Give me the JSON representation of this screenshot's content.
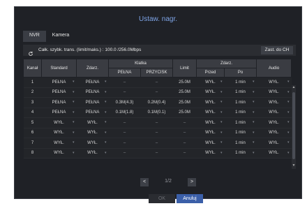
{
  "title": "Ustaw. nagr.",
  "tabs": [
    "NVR",
    "Kamera"
  ],
  "info": "Całk. szybk. trans. (limit/maks.) : 100.0 /256.0Mbps",
  "apply_button": "Zast. do CH",
  "headers": {
    "channel": "Kanał",
    "standard": "Standard",
    "event": "Zdarz.",
    "frame": "Klatka",
    "full": "PEŁNA",
    "switch": "PRZYCISK",
    "limit": "Limit",
    "event2": "Zdarz.",
    "before": "Przed",
    "after": "Po",
    "audio": "Audio"
  },
  "rows": [
    {
      "ch": "1",
      "standard": "PEŁNA",
      "event": "PEŁNA",
      "full": "–",
      "switch": "–",
      "limit": "25.0M",
      "before": "WYŁ.",
      "after": "1 min",
      "audio": "WYŁ."
    },
    {
      "ch": "2",
      "standard": "PEŁNA",
      "event": "PEŁNA",
      "full": "–",
      "switch": "–",
      "limit": "25.0M",
      "before": "WYŁ.",
      "after": "1 min",
      "audio": "WYŁ."
    },
    {
      "ch": "3",
      "standard": "PEŁNA",
      "event": "PEŁNA",
      "full": "0.3M(4.3)",
      "switch": "0.2M(0.4)",
      "limit": "25.0M",
      "before": "WYŁ.",
      "after": "1 min",
      "audio": "WYŁ."
    },
    {
      "ch": "4",
      "standard": "PEŁNA",
      "event": "PEŁNA",
      "full": "0.1M(1.8)",
      "switch": "0.1M(0.1)",
      "limit": "25.0M",
      "before": "WYŁ.",
      "after": "1 min",
      "audio": "WYŁ."
    },
    {
      "ch": "5",
      "standard": "WYŁ.",
      "event": "WYŁ.",
      "full": "–",
      "switch": "–",
      "limit": "–",
      "before": "WYŁ.",
      "after": "1 min",
      "audio": "WYŁ."
    },
    {
      "ch": "6",
      "standard": "WYŁ.",
      "event": "WYŁ.",
      "full": "–",
      "switch": "–",
      "limit": "–",
      "before": "WYŁ.",
      "after": "1 min",
      "audio": "WYŁ."
    },
    {
      "ch": "7",
      "standard": "WYŁ.",
      "event": "WYŁ.",
      "full": "–",
      "switch": "–",
      "limit": "–",
      "before": "WYŁ.",
      "after": "1 min",
      "audio": "WYŁ."
    },
    {
      "ch": "8",
      "standard": "WYŁ.",
      "event": "WYŁ.",
      "full": "–",
      "switch": "–",
      "limit": "–",
      "before": "WYŁ.",
      "after": "1 min",
      "audio": "WYŁ."
    }
  ],
  "pagination": "1/2",
  "ok_button": "OK",
  "cancel_button": "Anuluj"
}
